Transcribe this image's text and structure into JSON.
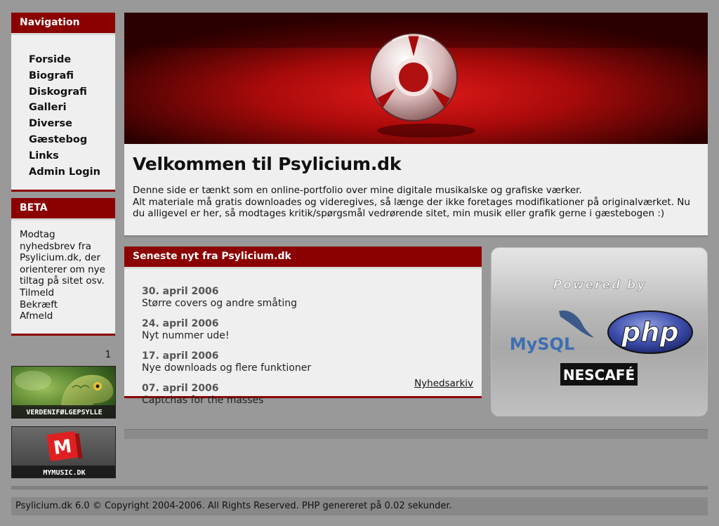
{
  "nav": {
    "title": "Navigation",
    "items": [
      "Forside",
      "Biografi",
      "Diskografi",
      "Galleri",
      "Diverse",
      "Gæstebog",
      "Links",
      "Admin Login"
    ]
  },
  "beta": {
    "title": "BETA",
    "text": "Modtag nyhedsbrev fra Psylicium.dk, der orienterer om nye tiltag på sitet osv.",
    "links": [
      "Tilmeld",
      "Bekræft",
      "Afmeld"
    ]
  },
  "counter": "1",
  "banners": {
    "b1": "VERDENIFØLGEPSYLLE",
    "b2": "MYMUSIC.DK",
    "b2_logo": "M"
  },
  "welcome": {
    "title": "Velkommen til Psylicium.dk",
    "line1": "Denne side er tænkt som en online-portfolio over mine digitale musikalske og grafiske værker.",
    "line2": "Alt materiale må gratis downloades og videregives, så længe der ikke foretages modifikationer på originalværket. Nu du alligevel er her, så modtages kritik/spørgsmål vedrørende sitet, min musik eller grafik gerne i gæstebogen :)"
  },
  "news": {
    "title": "Seneste nyt fra Psylicium.dk",
    "items": [
      {
        "date": "30. april 2006",
        "title": "Større covers og andre småting"
      },
      {
        "date": "24. april 2006",
        "title": "Nyt nummer ude!"
      },
      {
        "date": "17. april 2006",
        "title": "Nye downloads og flere funktioner"
      },
      {
        "date": "07. april 2006",
        "title": "Captchas for the masses"
      }
    ],
    "archive": "Nyhedsarkiv"
  },
  "powered": {
    "caption": "Powered by",
    "mysql": "MySQL",
    "php": "php",
    "nescafe": "NESCAFÉ"
  },
  "footer": "Psylicium.dk 6.0 © Copyright 2004-2006. All Rights Reserved. PHP genereret på 0.02 sekunder.",
  "colors": {
    "accent": "#8b0000",
    "page_bg": "#999999",
    "panel_bg": "#efefef"
  }
}
